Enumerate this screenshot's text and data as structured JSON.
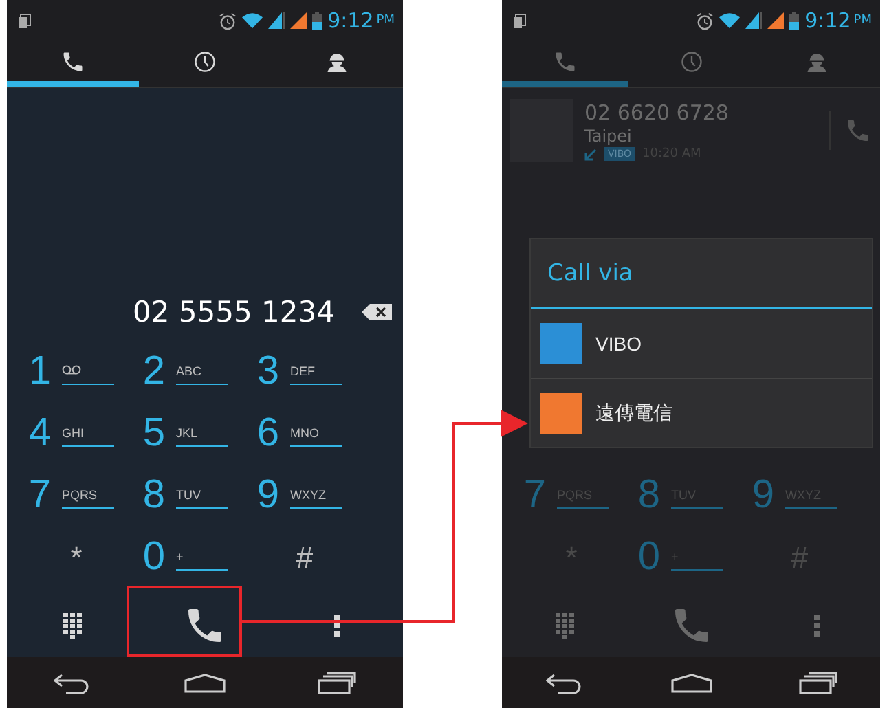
{
  "left_phone": {
    "dimmed": false,
    "status_bar": {
      "time": "9:12",
      "meridiem": "PM"
    },
    "tabs": [
      {
        "kind": "phone",
        "selected": true
      },
      {
        "kind": "clock",
        "selected": false
      },
      {
        "kind": "person",
        "selected": false
      }
    ],
    "number": "02 5555 1234",
    "keypad": [
      {
        "kind": "voicemail",
        "digit": "1"
      },
      {
        "kind": "digit",
        "digit": "2",
        "letters": "ABC"
      },
      {
        "kind": "digit",
        "digit": "3",
        "letters": "DEF"
      },
      {
        "kind": "digit",
        "digit": "4",
        "letters": "GHI"
      },
      {
        "kind": "digit",
        "digit": "5",
        "letters": "JKL"
      },
      {
        "kind": "digit",
        "digit": "6",
        "letters": "MNO"
      },
      {
        "kind": "digit",
        "digit": "7",
        "letters": "PQRS"
      },
      {
        "kind": "digit",
        "digit": "8",
        "letters": "TUV"
      },
      {
        "kind": "digit",
        "digit": "9",
        "letters": "WXYZ"
      },
      {
        "kind": "symbol",
        "digit": "*"
      },
      {
        "kind": "digit",
        "digit": "0",
        "letters": "+"
      },
      {
        "kind": "symbol",
        "digit": "#"
      }
    ]
  },
  "right_phone": {
    "dimmed": true,
    "status_bar": {
      "time": "9:12",
      "meridiem": "PM"
    },
    "tabs": [
      {
        "kind": "phone",
        "selected": true
      },
      {
        "kind": "clock",
        "selected": false
      },
      {
        "kind": "person",
        "selected": false
      }
    ],
    "recent_call": {
      "number": "02 6620 6728",
      "location": "Taipei",
      "sim": "VIBO",
      "time": "10:20 AM"
    },
    "keypad": [
      {
        "kind": "digit",
        "digit": "7",
        "letters": "PQRS"
      },
      {
        "kind": "digit",
        "digit": "8",
        "letters": "TUV"
      },
      {
        "kind": "digit",
        "digit": "9",
        "letters": "WXYZ"
      },
      {
        "kind": "symbol",
        "digit": "*"
      },
      {
        "kind": "digit",
        "digit": "0",
        "letters": "+"
      },
      {
        "kind": "symbol",
        "digit": "#"
      }
    ],
    "dialog": {
      "title": "Call via",
      "options": [
        {
          "label": "VIBO",
          "color": "#2b8fd6"
        },
        {
          "label": "遠傳電信",
          "color": "#f07830"
        }
      ]
    }
  }
}
